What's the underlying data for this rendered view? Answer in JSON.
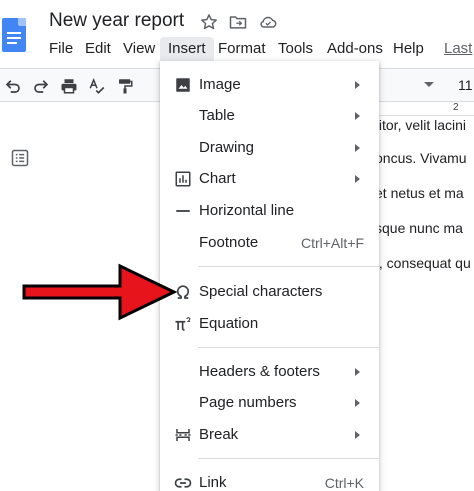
{
  "document": {
    "title": "New year report"
  },
  "menubar": {
    "items": [
      {
        "label": "File"
      },
      {
        "label": "Edit"
      },
      {
        "label": "View"
      },
      {
        "label": "Insert"
      },
      {
        "label": "Format"
      },
      {
        "label": "Tools"
      },
      {
        "label": "Add-ons"
      },
      {
        "label": "Help"
      },
      {
        "label": "Last"
      }
    ]
  },
  "toolbar": {
    "font_size": "11"
  },
  "ruler": {
    "marker": "2"
  },
  "page": {
    "lines": [
      "titor, velit lacini",
      "oncus. Vivamu",
      "et netus et ma",
      "sque nunc ma",
      "t, consequat qu"
    ]
  },
  "insert_menu": {
    "items": [
      {
        "label": "Image",
        "icon": "image-icon",
        "submenu": true
      },
      {
        "label": "Table",
        "icon": "",
        "submenu": true
      },
      {
        "label": "Drawing",
        "icon": "",
        "submenu": true
      },
      {
        "label": "Chart",
        "icon": "chart-icon",
        "submenu": true
      },
      {
        "label": "Horizontal line",
        "icon": "horizontal-line-icon",
        "submenu": false
      },
      {
        "label": "Footnote",
        "icon": "",
        "shortcut": "Ctrl+Alt+F",
        "submenu": false
      },
      {
        "label": "Special characters",
        "icon": "omega-icon",
        "submenu": false
      },
      {
        "label": "Equation",
        "icon": "pi-icon",
        "submenu": false
      },
      {
        "label": "Headers & footers",
        "icon": "",
        "submenu": true
      },
      {
        "label": "Page numbers",
        "icon": "",
        "submenu": true
      },
      {
        "label": "Break",
        "icon": "break-icon",
        "submenu": true
      },
      {
        "label": "Link",
        "icon": "link-icon",
        "shortcut": "Ctrl+K",
        "submenu": false
      }
    ]
  },
  "colors": {
    "docs_blue": "#4285f4",
    "arrow_red": "#e8141b",
    "menu_highlight": "#e8eaed"
  }
}
